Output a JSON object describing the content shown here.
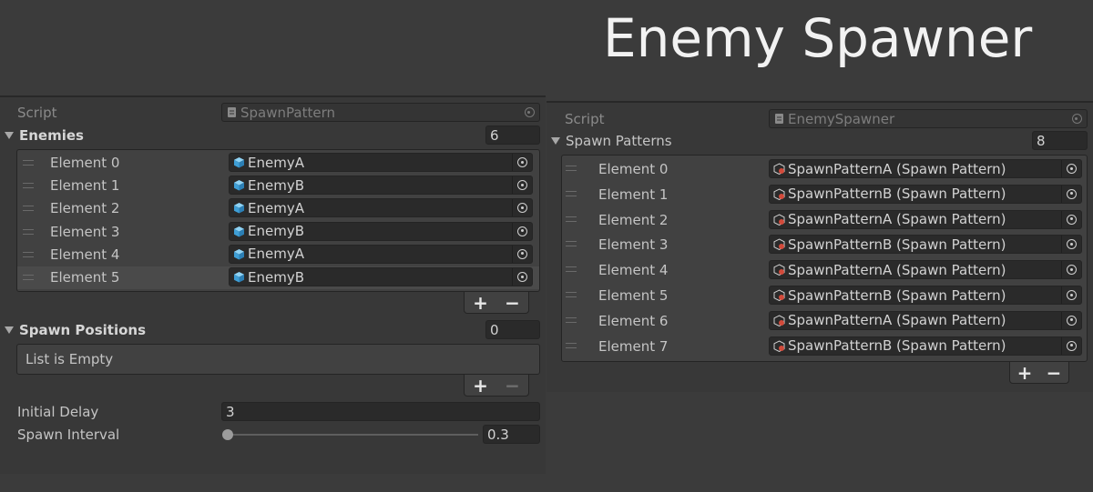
{
  "banner": {
    "title": "Enemy Spawner"
  },
  "left": {
    "script": {
      "label": "Script",
      "value": "SpawnPattern"
    },
    "enemies": {
      "label": "Enemies",
      "count": "6",
      "items": [
        {
          "label": "Element 0",
          "value": "EnemyA"
        },
        {
          "label": "Element 1",
          "value": "EnemyB"
        },
        {
          "label": "Element 2",
          "value": "EnemyA"
        },
        {
          "label": "Element 3",
          "value": "EnemyB"
        },
        {
          "label": "Element 4",
          "value": "EnemyA"
        },
        {
          "label": "Element 5",
          "value": "EnemyB"
        }
      ]
    },
    "spawn_positions": {
      "label": "Spawn Positions",
      "count": "0",
      "empty_text": "List is Empty"
    },
    "initial_delay": {
      "label": "Initial Delay",
      "value": "3"
    },
    "spawn_interval": {
      "label": "Spawn Interval",
      "value": "0.3",
      "slider_fraction": 0.0
    },
    "add_label": "+",
    "remove_label": "−"
  },
  "right": {
    "script": {
      "label": "Script",
      "value": "EnemySpawner"
    },
    "spawn_patterns": {
      "label": "Spawn Patterns",
      "count": "8",
      "items": [
        {
          "label": "Element 0",
          "value": "SpawnPatternA (Spawn Pattern)"
        },
        {
          "label": "Element 1",
          "value": "SpawnPatternB (Spawn Pattern)"
        },
        {
          "label": "Element 2",
          "value": "SpawnPatternA (Spawn Pattern)"
        },
        {
          "label": "Element 3",
          "value": "SpawnPatternB (Spawn Pattern)"
        },
        {
          "label": "Element 4",
          "value": "SpawnPatternA (Spawn Pattern)"
        },
        {
          "label": "Element 5",
          "value": "SpawnPatternB (Spawn Pattern)"
        },
        {
          "label": "Element 6",
          "value": "SpawnPatternA (Spawn Pattern)"
        },
        {
          "label": "Element 7",
          "value": "SpawnPatternB (Spawn Pattern)"
        }
      ]
    },
    "add_label": "+",
    "remove_label": "−"
  },
  "icons": {
    "script": "script-file-icon",
    "prefab": "prefab-cube-icon",
    "scriptable": "scriptable-object-icon",
    "picker": "object-picker-icon"
  },
  "colors": {
    "prefab_blue": "#4fb3e6",
    "background": "#3b3b3b",
    "panel": "#383838",
    "field": "#2a2a2a"
  }
}
